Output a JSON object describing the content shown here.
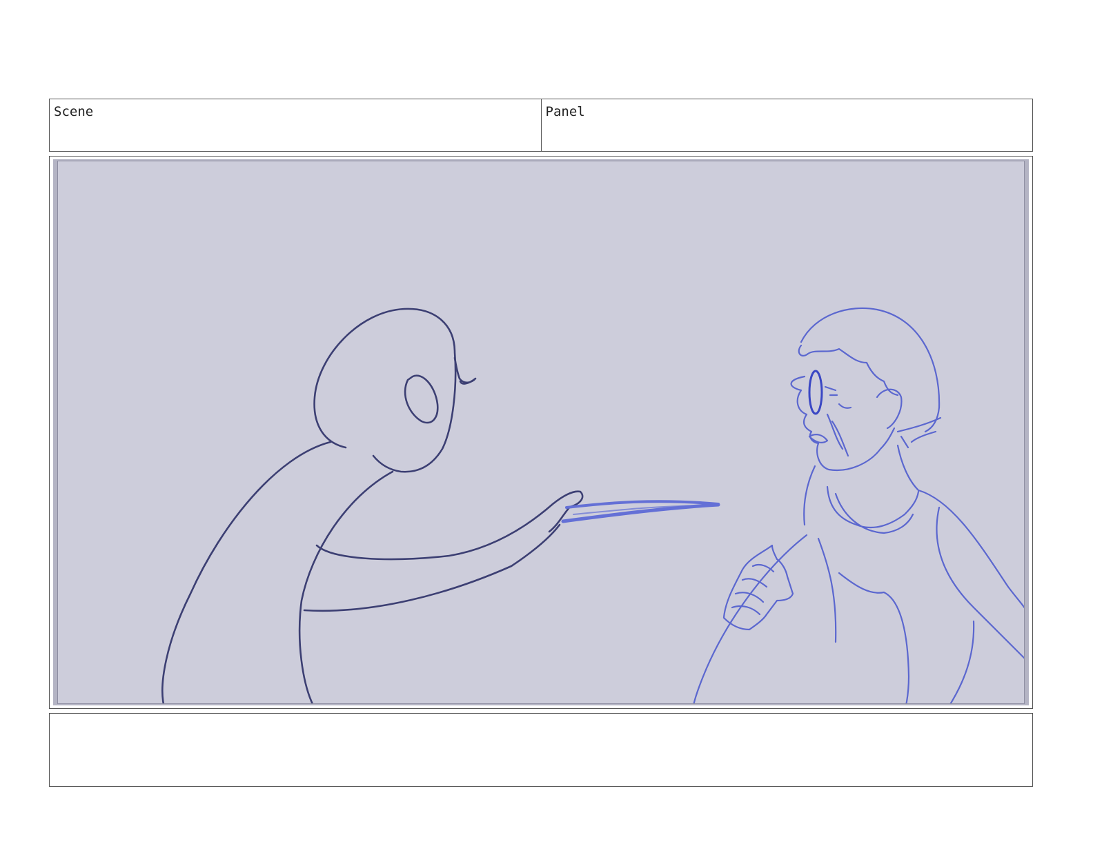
{
  "header": {
    "scene_label": "Scene",
    "panel_label": "Panel"
  },
  "panel_sketch": {
    "left_figure_color": "#3c3f73",
    "right_figure_color": "#5b67cf",
    "knife_color": "#6470d6",
    "glasses_color": "#3a47c4",
    "background_color": "#cdcddb"
  },
  "notes": {
    "text": ""
  }
}
